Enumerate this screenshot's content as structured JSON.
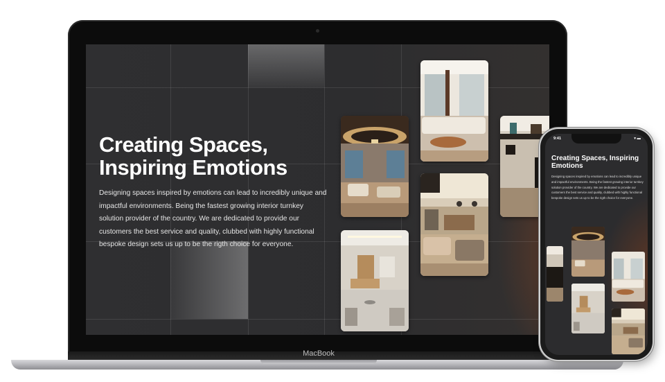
{
  "device_brand": "MacBook",
  "hero": {
    "title": "Creating Spaces, Inspiring Emotions",
    "description": "Designing spaces inspired by emotions can lead to incredibly unique and impactful environments. Being the fastest growing interior turnkey solution provider of the country. We are dedicated to provide our customers the best service and quality, clubbed with highly functional bespoke design sets us up to be the rigth choice for everyone."
  },
  "phone": {
    "status_time": "9:41",
    "status_icons": "▾ ▬",
    "title": "Creating Spaces, Inspiring Emotions",
    "description": "Designing spaces inspired by emotions can lead to incredibly unique and impactful environments. Being the fastest growing interior turnkey solution provider of the country. We are dedicated to provide our customers the best service and quality, clubbed with highly functional bespoke design sets us up to be the rigth choice for everyone."
  },
  "gallery": [
    {
      "name": "gallery-photo-lobby-chandelier"
    },
    {
      "name": "gallery-photo-reception"
    },
    {
      "name": "gallery-photo-living-room"
    },
    {
      "name": "gallery-photo-lounge"
    },
    {
      "name": "gallery-photo-hallway"
    }
  ],
  "colors": {
    "screen_bg": "#2e2e30",
    "accent_glow": "#783e23",
    "text_primary": "#ffffff"
  }
}
